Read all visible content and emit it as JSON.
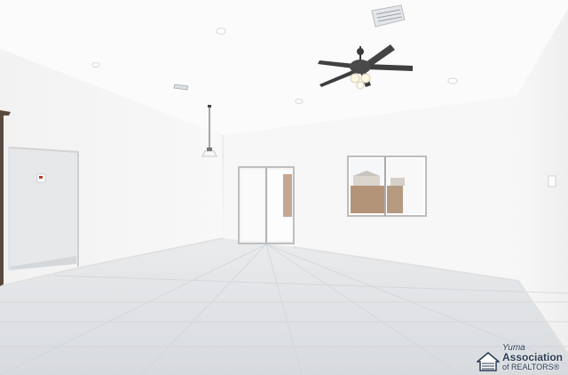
{
  "photo": {
    "subject": "Empty living room interior with vaulted ceiling, ceiling fan, pendant light, sliding glass door and window",
    "colors": {
      "wall": "#f6f6f6",
      "ceiling": "#fbfbfb",
      "floor_tile": "#dcdfe2",
      "fan_dark": "#3a3a3a",
      "brand_navy": "#2a3b55"
    }
  },
  "watermark": {
    "line1": "Yuma",
    "line2": "Association",
    "line3": "of REALTORS®"
  }
}
